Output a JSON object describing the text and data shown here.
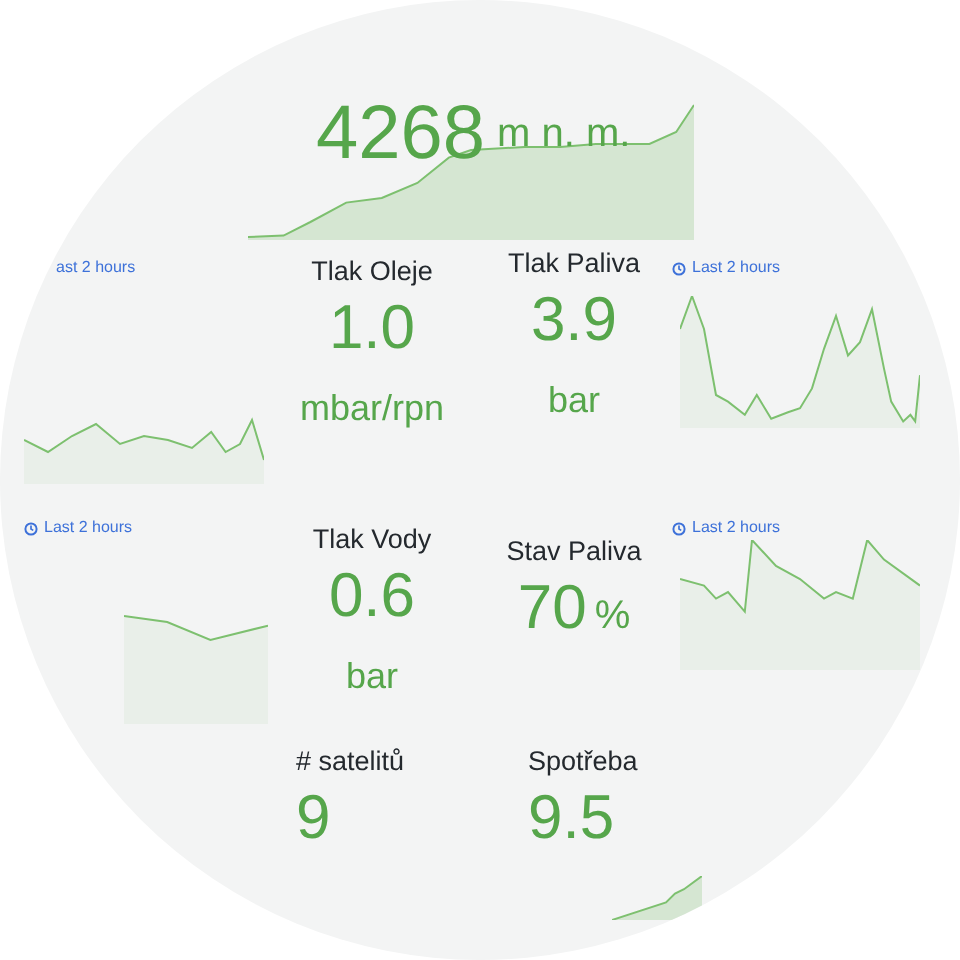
{
  "altitude": {
    "value": "4268",
    "unit": "m n. m."
  },
  "time_ranges": [
    {
      "label": "ast 2 hours",
      "icon": false
    },
    {
      "label": "Last 2 hours",
      "icon": true
    },
    {
      "label": "Last 2 hours",
      "icon": true
    },
    {
      "label": "Last 2 hours",
      "icon": true
    }
  ],
  "stats": [
    {
      "title": "Tlak Oleje",
      "value": "1.0",
      "unit": "mbar/rpn"
    },
    {
      "title": "Tlak Paliva",
      "value": "3.9",
      "unit": "bar"
    },
    {
      "title": "Tlak Vody",
      "value": "0.6",
      "unit": "bar"
    },
    {
      "title": "Stav Paliva",
      "value": "70",
      "unit": "%"
    },
    {
      "title": "# satelitů",
      "value": "9"
    },
    {
      "title": "Spotřeba",
      "value": "9.5"
    }
  ]
}
